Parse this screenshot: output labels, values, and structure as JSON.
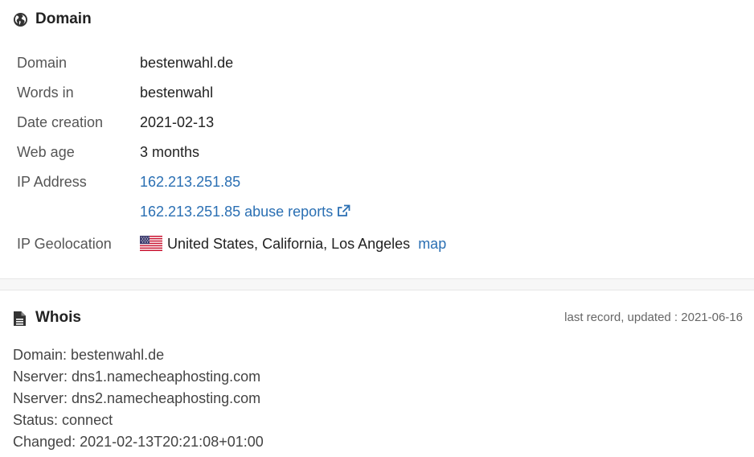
{
  "domain_section": {
    "title": "Domain",
    "icon": "globe-icon",
    "rows": {
      "domain": {
        "label": "Domain",
        "value": "bestenwahl.de"
      },
      "words_in": {
        "label": "Words in",
        "value": "bestenwahl"
      },
      "date_creation": {
        "label": "Date creation",
        "value": "2021-02-13"
      },
      "web_age": {
        "label": "Web age",
        "value": "3 months"
      },
      "ip_address": {
        "label": "IP Address",
        "value": "162.213.251.85"
      },
      "abuse": {
        "label": "",
        "value": "162.213.251.85 abuse reports"
      },
      "geolocation": {
        "label": "IP Geolocation",
        "value": "United States, California, Los Angeles",
        "map_label": "map",
        "flag": "us-flag-icon"
      }
    },
    "link_color": "#2a6fb3"
  },
  "whois_section": {
    "title": "Whois",
    "icon": "document-icon",
    "updated": "last record, updated : 2021-06-16",
    "lines": [
      "Domain: bestenwahl.de",
      "Nserver: dns1.namecheaphosting.com",
      "Nserver: dns2.namecheaphosting.com",
      "Status: connect",
      "Changed: 2021-02-13T20:21:08+01:00"
    ]
  }
}
